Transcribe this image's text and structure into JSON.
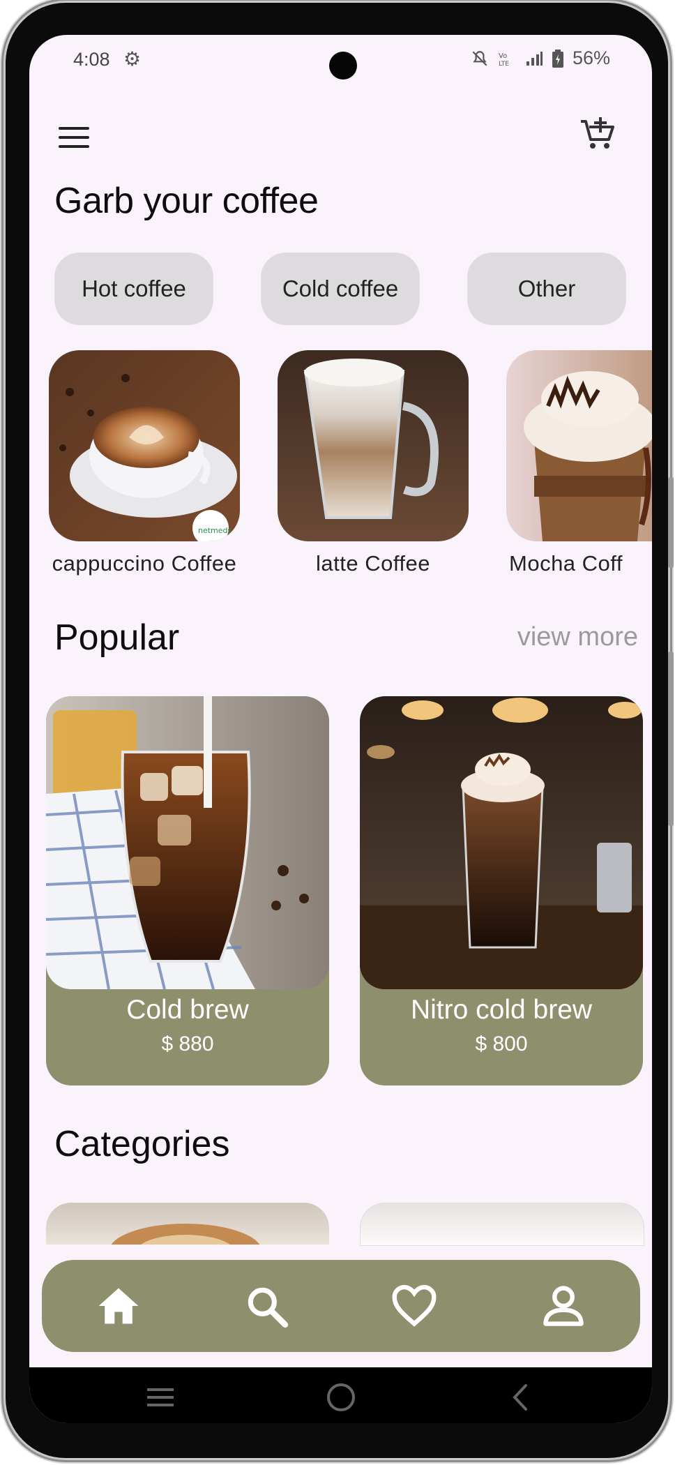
{
  "status_bar": {
    "time": "4:08",
    "battery": "56%",
    "icons": [
      "settings-icon",
      "mute-icon",
      "volte-icon",
      "signal-icon",
      "battery-icon"
    ]
  },
  "app_bar": {
    "icons": [
      "menu-icon",
      "add-to-cart-icon"
    ]
  },
  "header": {
    "title": "Garb your coffee"
  },
  "chips": [
    "Hot coffee",
    "Cold coffee",
    "Other"
  ],
  "coffee_types": [
    {
      "label": "cappuccino Coffee"
    },
    {
      "label": "latte Coffee"
    },
    {
      "label": "Mocha Coff"
    }
  ],
  "popular": {
    "title": "Popular",
    "view_more": "view more",
    "items": [
      {
        "name": "Cold brew",
        "price": "$ 880"
      },
      {
        "name": "Nitro cold brew",
        "price": "$ 800"
      }
    ]
  },
  "categories": {
    "title": "Categories"
  },
  "bottom_nav": [
    "home-icon",
    "search-icon",
    "heart-icon",
    "person-icon"
  ],
  "colors": {
    "background": "#fbf3fb",
    "chip": "#dedbde",
    "accent": "#8e8f6d",
    "muted_text": "#9a9a9a"
  }
}
